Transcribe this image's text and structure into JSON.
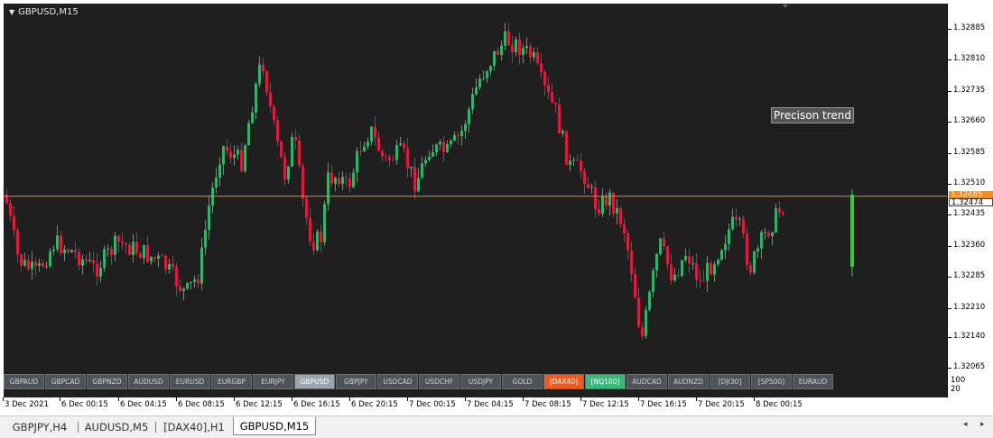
{
  "chart": {
    "title": "GBPUSD,M15",
    "colors": {
      "bull": "#2fb56a",
      "bear": "#e0193f",
      "hline": "#f28c1e",
      "background": "#1f1f1f",
      "last_bar": "#37c837"
    },
    "annotation": "Precison trend",
    "price_labels": [
      "1.32885",
      "1.32810",
      "1.32735",
      "1.32660",
      "1.32585",
      "1.32510",
      "1.32435",
      "1.32360",
      "1.32285",
      "1.32210",
      "1.32140",
      "1.32065"
    ],
    "current_price_labels": {
      "top": "1.32485",
      "bottom": "1.32474"
    },
    "horizontal_line_price": 1.3248,
    "indicator_levels": [
      "100",
      "20"
    ],
    "time_labels": [
      "3 Dec 2021",
      "6 Dec 00:15",
      "6 Dec 04:15",
      "6 Dec 08:15",
      "6 Dec 12:15",
      "6 Dec 16:15",
      "6 Dec 20:15",
      "7 Dec 00:15",
      "7 Dec 04:15",
      "7 Dec 08:15",
      "7 Dec 12:15",
      "7 Dec 16:15",
      "7 Dec 20:15",
      "8 Dec 00:15"
    ]
  },
  "symbol_buttons": [
    {
      "label": "GBPAUD",
      "style": "normal"
    },
    {
      "label": "GBPCAD",
      "style": "normal"
    },
    {
      "label": "GBPNZD",
      "style": "normal"
    },
    {
      "label": "AUDUSD",
      "style": "normal"
    },
    {
      "label": "EURUSD",
      "style": "normal"
    },
    {
      "label": "EURGBP",
      "style": "normal"
    },
    {
      "label": "EURJPY",
      "style": "normal"
    },
    {
      "label": "GBPUSD",
      "style": "active"
    },
    {
      "label": "GBPJPY",
      "style": "normal"
    },
    {
      "label": "USDCAD",
      "style": "normal"
    },
    {
      "label": "USDCHF",
      "style": "normal"
    },
    {
      "label": "USDJPY",
      "style": "normal"
    },
    {
      "label": "GOLD",
      "style": "normal"
    },
    {
      "label": "[DAX40]",
      "style": "orange"
    },
    {
      "label": "[NQ100]",
      "style": "green"
    },
    {
      "label": "AUDCAD",
      "style": "normal"
    },
    {
      "label": "AUDNZD",
      "style": "normal"
    },
    {
      "label": "[DJI30]",
      "style": "normal"
    },
    {
      "label": "[SP500]",
      "style": "normal"
    },
    {
      "label": "EURAUD",
      "style": "normal"
    }
  ],
  "tabs": [
    {
      "label": "GBPJPY,H4",
      "active": false
    },
    {
      "label": "AUDUSD,M5",
      "active": false
    },
    {
      "label": "[DAX40],H1",
      "active": false
    },
    {
      "label": "GBPUSD,M15",
      "active": true
    }
  ],
  "tab_scroll": {
    "left": "◂",
    "right": "▸"
  }
}
